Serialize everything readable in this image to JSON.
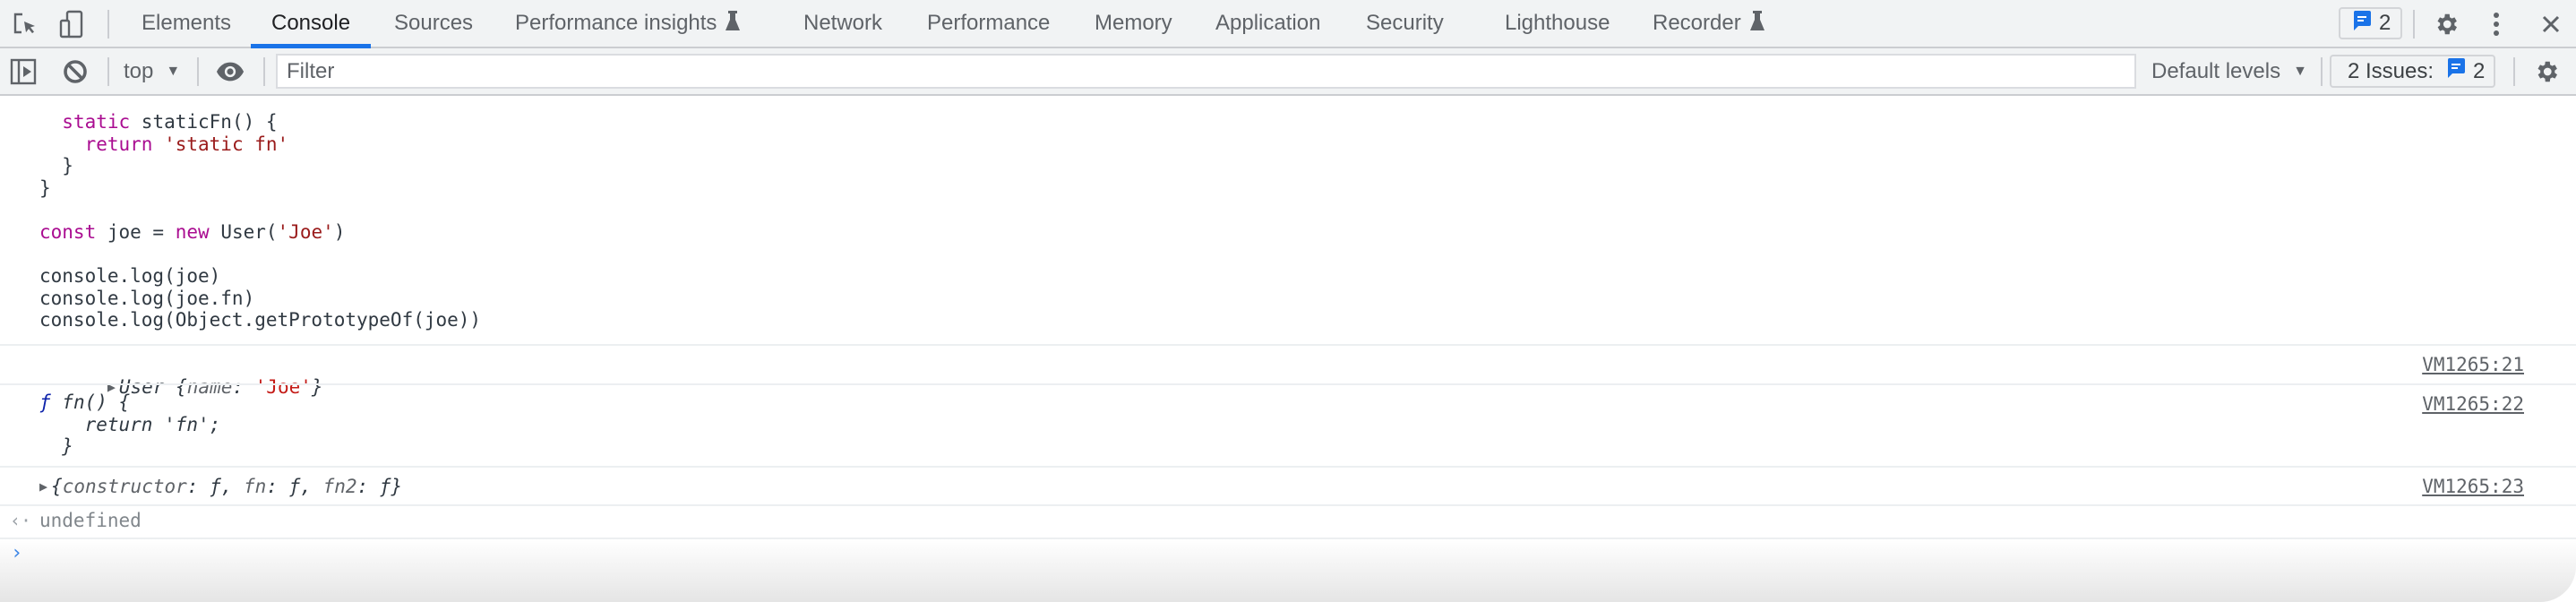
{
  "tabbar": {
    "icons": [
      "inspect-element-icon",
      "device-toolbar-icon"
    ],
    "tabs": [
      {
        "label": "Elements",
        "active": false,
        "experimental": false
      },
      {
        "label": "Console",
        "active": true,
        "experimental": false
      },
      {
        "label": "Sources",
        "active": false,
        "experimental": false
      },
      {
        "label": "Performance insights",
        "active": false,
        "experimental": true
      },
      {
        "label": "Network",
        "active": false,
        "experimental": false
      },
      {
        "label": "Performance",
        "active": false,
        "experimental": false
      },
      {
        "label": "Memory",
        "active": false,
        "experimental": false
      },
      {
        "label": "Application",
        "active": false,
        "experimental": false
      },
      {
        "label": "Security",
        "active": false,
        "experimental": false
      },
      {
        "label": "Lighthouse",
        "active": false,
        "experimental": false
      },
      {
        "label": "Recorder",
        "active": false,
        "experimental": true
      }
    ],
    "issues_badge_count": "2",
    "right_icons": [
      "settings-gear-icon",
      "more-vert-icon",
      "close-icon"
    ]
  },
  "toolbar": {
    "context": "top",
    "filter_placeholder": "Filter",
    "filter_value": "",
    "levels_label": "Default levels",
    "issues_label": "2 Issues:",
    "issues_count": "2"
  },
  "colors": {
    "accent": "#1a73e8",
    "keyword": "#aa0d91",
    "string": "#c41a16",
    "toolbar_bg": "#f1f3f4"
  },
  "console": {
    "code_lines": [
      [
        {
          "t": "  "
        },
        {
          "t": "static",
          "c": "kw"
        },
        {
          "t": " staticFn() {"
        }
      ],
      [
        {
          "t": "    "
        },
        {
          "t": "return",
          "c": "kw"
        },
        {
          "t": " "
        },
        {
          "t": "'static fn'",
          "c": "strdark"
        }
      ],
      [
        {
          "t": "  }"
        }
      ],
      [
        {
          "t": "}"
        }
      ],
      [
        {
          "t": ""
        }
      ],
      [
        {
          "t": "const",
          "c": "kw"
        },
        {
          "t": " joe = "
        },
        {
          "t": "new",
          "c": "kw"
        },
        {
          "t": " User("
        },
        {
          "t": "'Joe'",
          "c": "strdark"
        },
        {
          "t": ")"
        }
      ],
      [
        {
          "t": ""
        }
      ],
      [
        {
          "t": "console.log(joe)"
        }
      ],
      [
        {
          "t": "console.log(joe.fn)"
        }
      ],
      [
        {
          "t": "console.log(Object.getPrototypeOf(joe))"
        }
      ]
    ],
    "messages": [
      {
        "type": "object",
        "class_name": "User",
        "open": "{",
        "key": "name",
        "value": "'Joe'",
        "close": "}",
        "source": "VM1265:21"
      },
      {
        "type": "function",
        "f_symbol": "ƒ",
        "lines": [
          " fn() {",
          "    return 'fn';",
          "  }"
        ],
        "source": "VM1265:22"
      },
      {
        "type": "object",
        "text_parts": [
          {
            "t": "{",
            "c": ""
          },
          {
            "t": "constructor",
            "c": "prop"
          },
          {
            "t": ": ",
            "c": ""
          },
          {
            "t": "ƒ",
            "c": ""
          },
          {
            "t": ", ",
            "c": ""
          },
          {
            "t": "fn",
            "c": "prop"
          },
          {
            "t": ": ",
            "c": ""
          },
          {
            "t": "ƒ",
            "c": ""
          },
          {
            "t": ", ",
            "c": ""
          },
          {
            "t": "fn2",
            "c": "prop"
          },
          {
            "t": ": ",
            "c": ""
          },
          {
            "t": "ƒ",
            "c": ""
          },
          {
            "t": "}",
            "c": ""
          }
        ],
        "source": "VM1265:23"
      }
    ],
    "result": "undefined",
    "prompt_value": ""
  }
}
